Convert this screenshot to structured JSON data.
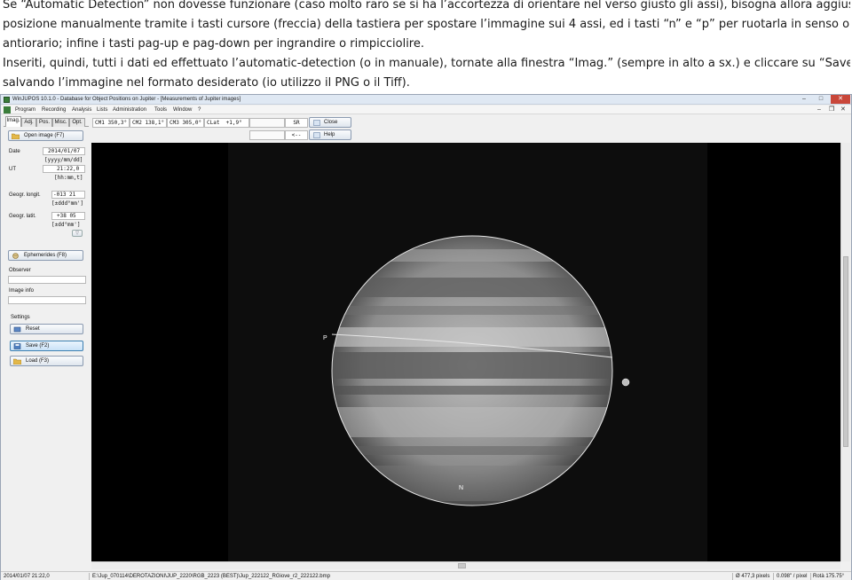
{
  "instructions": {
    "line1": "Se “Automatic Detection” non dovesse funzionare (caso molto raro se si ha l’accortezza di orientare nel verso giusto gli assi), bisogna allora aggiustare la",
    "line2": "posizione manualmente tramite i tasti cursore (freccia) della tastiera per spostare l’immagine sui 4 assi, ed i tasti “n” e “p” per ruotarla in senso orario e",
    "line3": "antiorario; infine i tasti pag-up e pag-down per ingrandire o rimpicciolire.",
    "line4": "Inseriti, quindi, tutti i dati ed effettuato l’automatic-detection  (o in manuale), tornate alla finestra “Imag.” (sempre in alto a sx.) e cliccare su “Save”,",
    "line5": "salvando l’immagine nel formato desiderato (io utilizzo il PNG o il Tiff)."
  },
  "window": {
    "title": "WinJUPOS 10.1.0 - Database for Object Positions on Jupiter - [Measurements of Jupiter images]",
    "controls": {
      "minimize": "–",
      "maximize": "□",
      "close": "✕"
    },
    "mdi_controls": {
      "minimize": "–",
      "restore": "❐",
      "close": "✕"
    }
  },
  "menu": [
    "Program",
    "Recording",
    "Analysis",
    "Lists",
    "Administration",
    "Tools",
    "Window",
    "?"
  ],
  "tabs": [
    "Imag.",
    "Adj.",
    "Pos.",
    "Misc.",
    "Opt."
  ],
  "left_panel": {
    "open_image": "Open image (F7)",
    "date_label": "Date",
    "date_value": "2014/01/07",
    "date_format": "[yyyy/mm/dd]",
    "ut_label": "UT",
    "ut_value": "21:22,0",
    "ut_format": "[hh:mm,t]",
    "longitude_label": "Geogr. longit.",
    "longitude_value": "-013 21",
    "longitude_format": "[±ddd°mm']",
    "latitude_label": "Geogr. latit.",
    "latitude_value": "+38 05",
    "latitude_format": "[±dd°mm']",
    "ephemerides": "Ephemerides (F8)",
    "observer_label": "Observer",
    "observer_value": "",
    "image_info_label": "Image info",
    "image_info_value": "",
    "settings_label": "Settings",
    "reset": "Reset",
    "save": "Save (F2)",
    "load": "Load (F3)"
  },
  "toolbar": {
    "cm1": "CM1 350,3°",
    "cm2": "CM2 138,1°",
    "cm3": "CM3 305,0°",
    "clat": "CLat  +1,9°",
    "sr": "SR",
    "arrow": "<--",
    "close": "Close",
    "help": "Help"
  },
  "image": {
    "label_p": "P",
    "label_n": "N"
  },
  "status_bar": {
    "datetime": "2014/01/07  21:22,0",
    "path": "E:\\Jup_070114\\DEROTAZIONI\\JUP_2220\\RGB_2223 (BEST)\\Jup_222122_RGiove_r2_222122.bmp",
    "diameter": "Ø 477,3 pixels",
    "scale": "0.098\" / pixel",
    "rotation": "Rotà 175.75°"
  }
}
